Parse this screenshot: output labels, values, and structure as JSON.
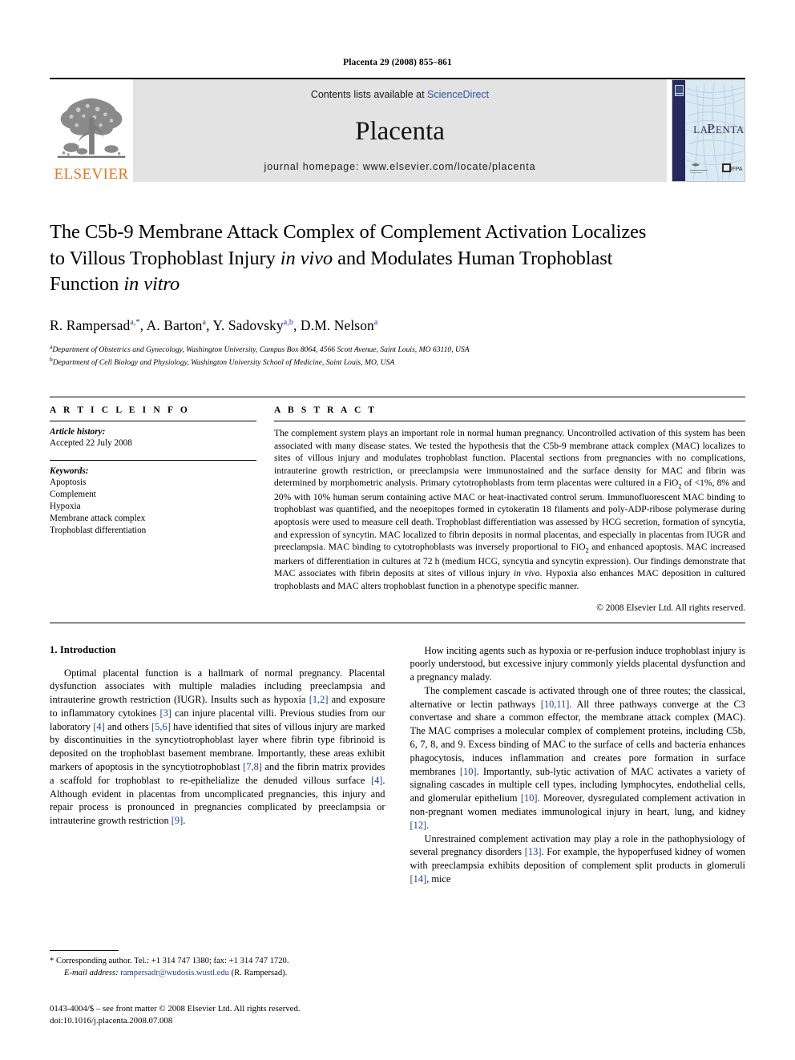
{
  "running_head": "Placenta 29 (2008) 855–861",
  "masthead": {
    "publisher_name": "ELSEVIER",
    "contents_prefix": "Contents lists available at ",
    "contents_link": "ScienceDirect",
    "journal_name": "Placenta",
    "homepage": "journal homepage: www.elsevier.com/locate/placenta",
    "cover_title": "PLACENTA"
  },
  "article": {
    "title_line1": "The C5b-9 Membrane Attack Complex of Complement Activation Localizes",
    "title_line2_a": "to Villous Trophoblast Injury ",
    "title_line2_italic": "in vivo",
    "title_line2_b": " and Modulates Human Trophoblast",
    "title_line3_a": "Function ",
    "title_line3_italic": "in vitro",
    "authors": "R. Rampersad, A. Barton, Y. Sadovsky, D.M. Nelson",
    "author_list": [
      {
        "name": "R. Rampersad",
        "marks": "a,*"
      },
      {
        "name": "A. Barton",
        "marks": "a"
      },
      {
        "name": "Y. Sadovsky",
        "marks": "a,b"
      },
      {
        "name": "D.M. Nelson",
        "marks": "a"
      }
    ],
    "affiliations": [
      {
        "mark": "a",
        "text": "Department of Obstetrics and Gynecology, Washington University, Campus Box 8064, 4566 Scott Avenue, Saint Louis, MO 63110, USA"
      },
      {
        "mark": "b",
        "text": "Department of Cell Biology and Physiology, Washington University School of Medicine, Saint Louis, MO, USA"
      }
    ]
  },
  "article_info": {
    "heading": "A R T I C L E  I N F O",
    "history_label": "Article history:",
    "history_value": "Accepted 22 July 2008",
    "keywords_label": "Keywords:",
    "keywords": [
      "Apoptosis",
      "Complement",
      "Hypoxia",
      "Membrane attack complex",
      "Trophoblast differentiation"
    ]
  },
  "abstract": {
    "heading": "A B S T R A C T",
    "part1": "The complement system plays an important role in normal human pregnancy. Uncontrolled activation of this system has been associated with many disease states. We tested the hypothesis that the C5b-9 membrane attack complex (MAC) localizes to sites of villous injury and modulates trophoblast function. Placental sections from pregnancies with no complications, intrauterine growth restriction, or preeclampsia were immunostained and the surface density for MAC and fibrin was determined by morphometric analysis. Primary cytotrophoblasts from term placentas were cultured in a FiO",
    "sub1": "2",
    "part2": " of <1%, 8% and 20% with 10% human serum containing active MAC or heat-inactivated control serum. Immunofluorescent MAC binding to trophoblast was quantified, and the neoepitopes formed in cytokeratin 18 filaments and poly-ADP-ribose polymerase during apoptosis were used to measure cell death. Trophoblast differentiation was assessed by HCG secretion, formation of syncytia, and expression of syncytin. MAC localized to fibrin deposits in normal placentas, and especially in placentas from IUGR and preeclampsia. MAC binding to cytotrophoblasts was inversely proportional to FiO",
    "sub2": "2",
    "part3": " and enhanced apoptosis. MAC increased markers of differentiation in cultures at 72 h (medium HCG, syncytia and syncytin expression). Our findings demonstrate that MAC associates with fibrin deposits at sites of villous injury ",
    "part3_italic": "in vivo",
    "part4": ". Hypoxia also enhances MAC deposition in cultured trophoblasts and MAC alters trophoblast function in a phenotype specific manner.",
    "copyright": "© 2008 Elsevier Ltd. All rights reserved."
  },
  "introduction": {
    "section_number_title": "1. Introduction",
    "left_paragraph_1_pre": "Optimal placental function is a hallmark of normal pregnancy. Placental dysfunction associates with multiple maladies including preeclampsia and intrauterine growth restriction (IUGR). Insults such as hypoxia ",
    "left_p1_ref1": "[1,2]",
    "left_p1_mid1": " and exposure to inflammatory cytokines ",
    "left_p1_ref2": "[3]",
    "left_p1_mid2": " can injure placental villi. Previous studies from our laboratory ",
    "left_p1_ref3": "[4]",
    "left_p1_mid3": " and others ",
    "left_p1_ref4": "[5,6]",
    "left_p1_mid4": " have identified that sites of villous injury are marked by discontinuities in the syncytiotrophoblast layer where fibrin type fibrinoid is deposited on the trophoblast basement membrane. Importantly, these areas exhibit markers of apoptosis in the syncytiotrophoblast ",
    "left_p1_ref5": "[7,8]",
    "left_p1_mid5": " and the fibrin matrix provides a scaffold for trophoblast to re-epithelialize the denuded villous surface ",
    "left_p1_ref6": "[4]",
    "left_p1_mid6": ". Although evident in placentas from uncomplicated pregnancies, this injury and repair process is pronounced in pregnancies complicated by preeclampsia or intrauterine growth restriction ",
    "left_p1_ref7": "[9]",
    "left_p1_end": ".",
    "right_paragraph_1": "How inciting agents such as hypoxia or re-perfusion induce trophoblast injury is poorly understood, but excessive injury commonly yields placental dysfunction and a pregnancy malady.",
    "right_p2_pre": "The complement cascade is activated through one of three routes; the classical, alternative or lectin pathways ",
    "right_p2_ref1": "[10,11]",
    "right_p2_mid1": ". All three pathways converge at the C3 convertase and share a common effector, the membrane attack complex (MAC). The MAC comprises a molecular complex of complement proteins, including C5b, 6, 7, 8, and 9. Excess binding of MAC to the surface of cells and bacteria enhances phagocytosis, induces inflammation and creates pore formation in surface membranes ",
    "right_p2_ref2": "[10]",
    "right_p2_mid2": ". Importantly, sub-lytic activation of MAC activates a variety of signaling cascades in multiple cell types, including lymphocytes, endothelial cells, and glomerular epithelium ",
    "right_p2_ref3": "[10]",
    "right_p2_mid3": ". Moreover, dysregulated complement activation in non-pregnant women mediates immunological injury in heart, lung, and kidney ",
    "right_p2_ref4": "[12]",
    "right_p2_end": ".",
    "right_p3_pre": "Unrestrained complement activation may play a role in the pathophysiology of several pregnancy disorders ",
    "right_p3_ref1": "[13]",
    "right_p3_mid1": ". For example, the hypoperfused kidney of women with preeclampsia exhibits deposition of complement split products in glomeruli ",
    "right_p3_ref2": "[14]",
    "right_p3_end": ", mice"
  },
  "footnote": {
    "corresponding": "* Corresponding author. Tel.: +1 314 747 1380; fax: +1 314 747 1720.",
    "email_label": "E-mail address:",
    "email": "rampersadr@wudosis.wustl.edu",
    "email_attrib": "(R. Rampersad)."
  },
  "imprint": {
    "line1": "0143-4004/$ – see front matter © 2008 Elsevier Ltd. All rights reserved.",
    "line2": "doi:10.1016/j.placenta.2008.07.008"
  },
  "colors": {
    "link_blue": "#2b56a6",
    "reference_blue": "#1c3f94",
    "elsevier_orange": "#e87722",
    "masthead_grey": "#e3e3e3",
    "cover_navy": "#27285c"
  }
}
